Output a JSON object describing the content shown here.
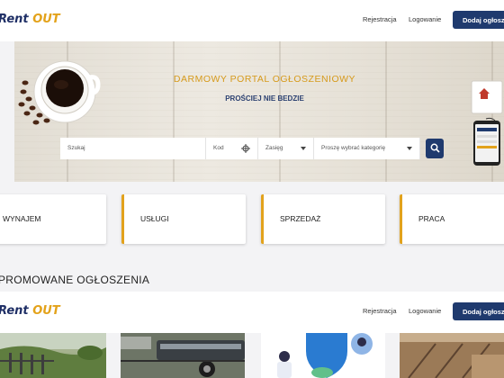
{
  "header": {
    "logo_main": "Rent",
    "logo_accent": "OUT",
    "register": "Rejestracja",
    "login": "Logowanie",
    "add_listing": "Dodaj ogłoszenie"
  },
  "hero": {
    "title": "DARMOWY PORTAL OGŁOSZENIOWY",
    "subtitle": "PROŚCIEJ NIE BEDZIE"
  },
  "search": {
    "placeholder": "Szukaj",
    "postcode": "Kod",
    "radius": "Zasięg",
    "category": "Proszę wybrać kategorię"
  },
  "categories": [
    "WYNAJEM",
    "USŁUGI",
    "SPRZEDAŻ",
    "PRACA"
  ],
  "section": {
    "title": "PROMOWANE OGŁOSZENIA"
  },
  "colors": {
    "brand_navy": "#1f3a6e",
    "brand_gold": "#e2a21c"
  }
}
